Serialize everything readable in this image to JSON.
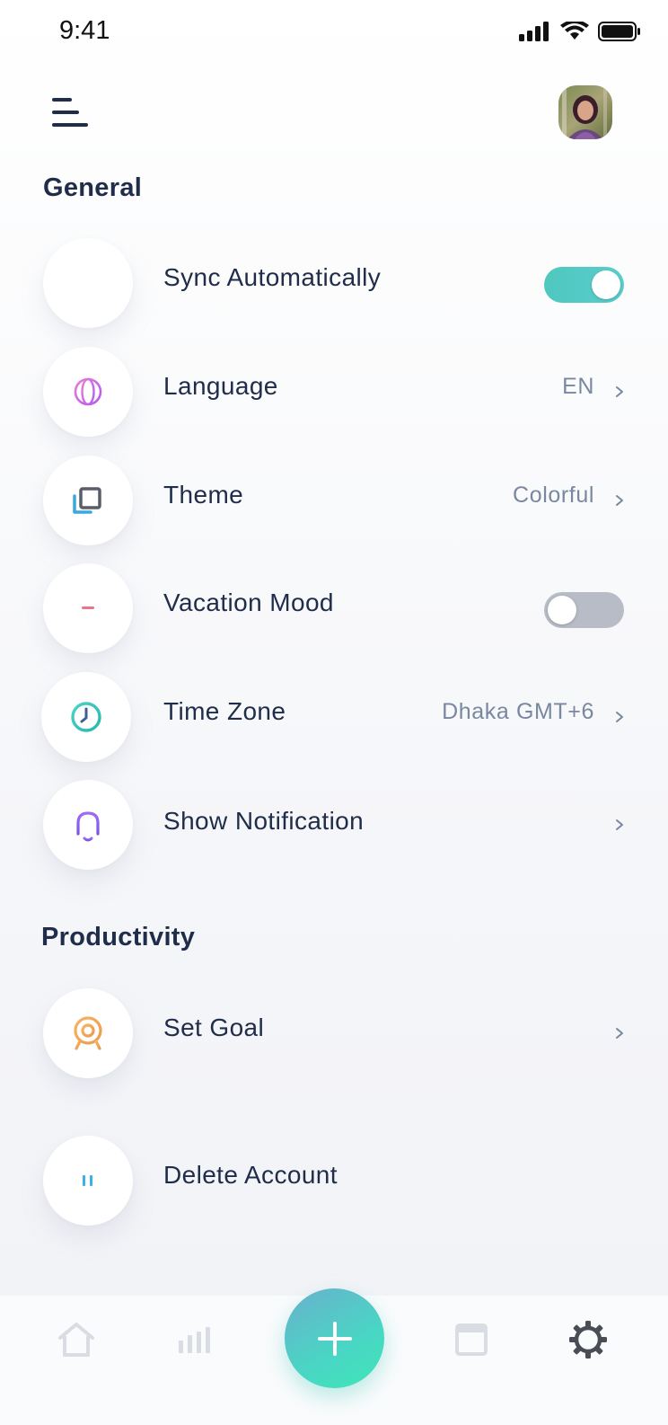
{
  "status_bar": {
    "time": "9:41"
  },
  "sections": {
    "general_title": "General",
    "productivity_title": "Productivity"
  },
  "settings": {
    "sync": {
      "label": "Sync Automatically",
      "enabled": true
    },
    "language": {
      "label": "Language",
      "value": "EN"
    },
    "theme": {
      "label": "Theme",
      "value": "Colorful"
    },
    "vacation": {
      "label": "Vacation Mood",
      "enabled": false
    },
    "timezone": {
      "label": "Time Zone",
      "value": "Dhaka GMT+6"
    },
    "notification": {
      "label": "Show Notification"
    },
    "goal": {
      "label": "Set Goal"
    },
    "delete": {
      "label": "Delete Account"
    }
  },
  "colors": {
    "text_primary": "#1f2d4a",
    "text_secondary": "#7a87a0",
    "toggle_on": "#4fc7bf",
    "toggle_off": "#b7bcc6",
    "fab_gradient_start": "#6ab0cd",
    "fab_gradient_end": "#3ee6b9",
    "globe_icon": "#d56cf0",
    "bell_icon": "#8a5cf0",
    "target_icon": "#f2a957",
    "clock_icon": "#2fc7be"
  },
  "icons": [
    "menu-icon",
    "globe-icon",
    "theme-icon",
    "vacation-icon",
    "clock-icon",
    "bell-icon",
    "target-icon",
    "pause-icon",
    "home-icon",
    "stats-icon",
    "plus-icon",
    "calendar-icon",
    "settings-gear-icon",
    "chevron-right-icon"
  ]
}
